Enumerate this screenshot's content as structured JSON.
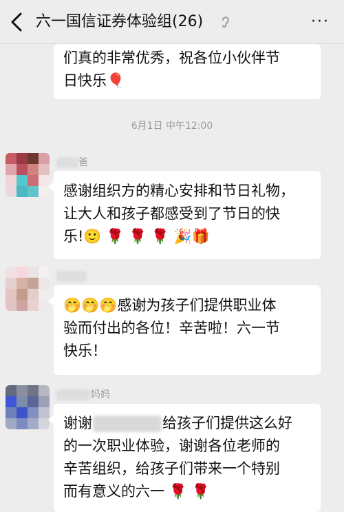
{
  "header": {
    "title": "六一国信证券体验组(26)",
    "more": "···"
  },
  "messages": [
    {
      "lines": [
        "们真的非常优秀，祝各位小伙伴节",
        "日快乐🎈"
      ]
    },
    {
      "name_suffix": "爸",
      "lines": [
        "感谢组织方的精心安排和节日礼物，",
        "让大人和孩子都感受到了节日的快",
        "乐!🙂 🌹 🌹 🌹 🎉🎁"
      ]
    },
    {
      "name_suffix": "",
      "lines": [
        "🤭🤭🤭感谢为孩子们提供职业体",
        "验而付出的各位！辛苦啦！六一节",
        "快乐！"
      ]
    },
    {
      "name_suffix": "妈妈",
      "line1_prefix": "谢谢",
      "line1_suffix": "给孩子们提供这么好",
      "lines": [
        "的一次职业体验，谢谢各位老师的",
        "辛苦组织，给孩子们带来一个特别",
        "而有意义的六一 🌹 🌹"
      ]
    }
  ],
  "timestamp": "6月1日 中午12:00",
  "colors": {
    "background": "#ededed",
    "bubble": "#ffffff",
    "meta": "#999999"
  }
}
